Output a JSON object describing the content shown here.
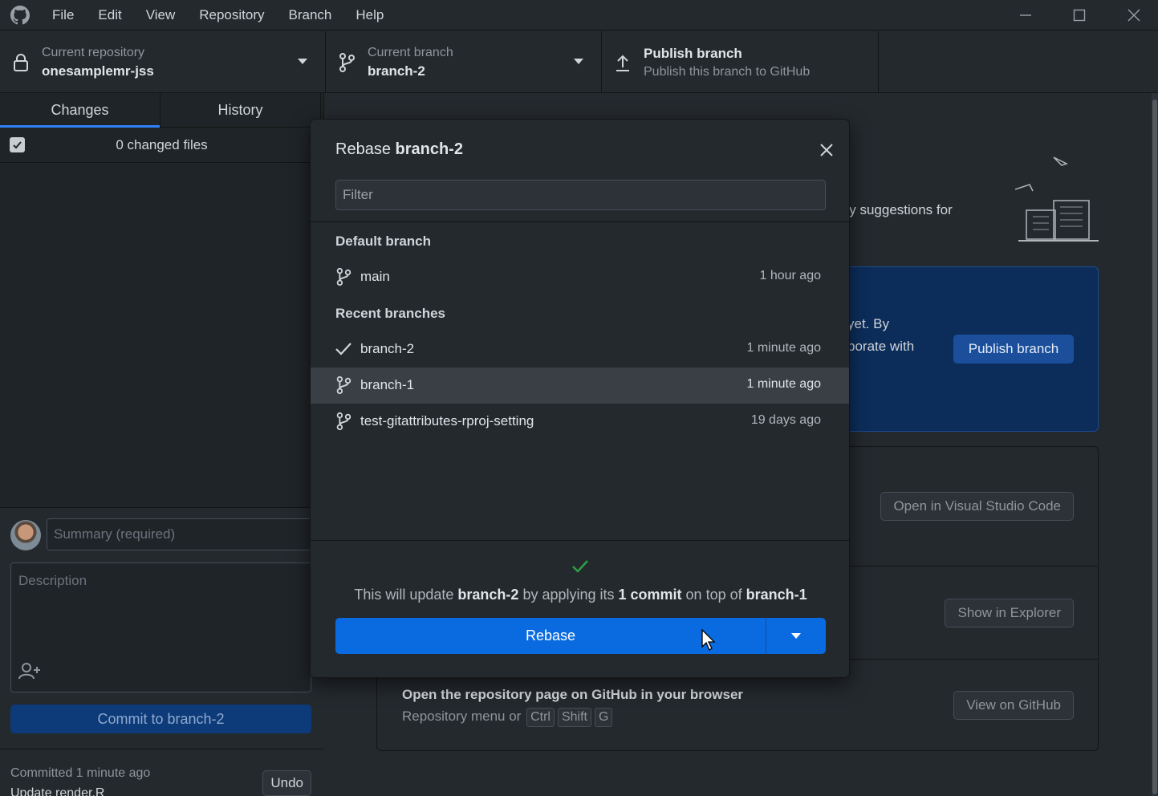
{
  "menu": {
    "logo_icon": "github-icon",
    "items": [
      "File",
      "Edit",
      "View",
      "Repository",
      "Branch",
      "Help"
    ]
  },
  "toolbar": {
    "repo": {
      "label": "Current repository",
      "value": "onesamplemr-jss",
      "icon": "lock-icon"
    },
    "branch": {
      "label": "Current branch",
      "value": "branch-2",
      "icon": "git-branch-icon"
    },
    "publish": {
      "label": "Publish branch",
      "sub": "Publish this branch to GitHub",
      "icon": "upload-icon"
    }
  },
  "sidebar": {
    "tabs": [
      "Changes",
      "History"
    ],
    "changed_files": "0 changed files",
    "summary_placeholder": "Summary (required)",
    "description_placeholder": "Description",
    "commit_button": "Commit to branch-2",
    "last_commit": {
      "status": "Committed 1 minute ago",
      "message": "Update render.R",
      "undo": "Undo"
    }
  },
  "main": {
    "suggest_text": "dly suggestions for",
    "publish_card": {
      "line1": "yet. By",
      "line2": "borate with",
      "button": "Publish branch"
    },
    "actions": {
      "vscode_button": "Open in Visual Studio Code",
      "explorer_button": "Show in Explorer",
      "github_title": "Open the repository page on GitHub in your browser",
      "github_sub": "Repository menu or",
      "keys": [
        "Ctrl",
        "Shift",
        "G"
      ],
      "github_button": "View on GitHub"
    }
  },
  "dialog": {
    "title_prefix": "Rebase",
    "title_branch": "branch-2",
    "filter_placeholder": "Filter",
    "default_label": "Default branch",
    "default_branch": {
      "name": "main",
      "time": "1 hour ago"
    },
    "recent_label": "Recent branches",
    "recent": [
      {
        "name": "branch-2",
        "time": "1 minute ago",
        "icon": "check-icon"
      },
      {
        "name": "branch-1",
        "time": "1 minute ago",
        "icon": "git-branch-icon",
        "selected": true
      },
      {
        "name": "test-gitattributes-rproj-setting",
        "time": "19 days ago",
        "icon": "git-branch-icon"
      }
    ],
    "message": {
      "p1": "This will update ",
      "b1": "branch-2",
      "p2": " by applying its ",
      "b2": "1 commit",
      "p3": " on top of ",
      "b3": "branch-1"
    },
    "rebase_button": "Rebase"
  },
  "colors": {
    "accent": "#0a6be0",
    "success": "#2ea043",
    "background": "#24292e"
  }
}
